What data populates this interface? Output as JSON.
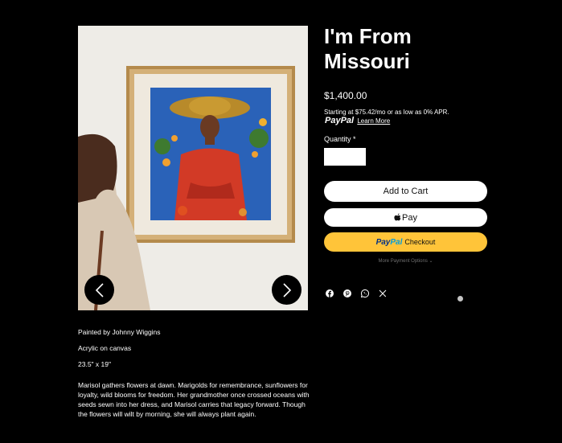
{
  "product": {
    "title_line1": "I'm From",
    "title_line2": "Missouri",
    "price": "$1,400.00",
    "financing_text": "Starting at $75.42/mo or as low as 0% APR.",
    "financing_brand": "PayPal",
    "financing_link": "Learn More",
    "quantity_label": "Quantity *",
    "quantity_value": ""
  },
  "buttons": {
    "add_to_cart": "Add to Cart",
    "apple_pay": "Pay",
    "paypal_brand_1": "Pay",
    "paypal_brand_2": "Pal",
    "paypal_checkout": "Checkout",
    "more_payment": "More Payment Options"
  },
  "gallery": {
    "prev_icon": "chevron-left-icon",
    "next_icon": "chevron-right-icon"
  },
  "share_icons": [
    "facebook-icon",
    "pinterest-icon",
    "whatsapp-icon",
    "x-icon"
  ],
  "details": {
    "artist": "Painted by Johnny Wiggins",
    "medium": "Acrylic on canvas",
    "size": "23.5\" x 19\"",
    "description": "Marisol gathers flowers at dawn. Marigolds for remembrance, sunflowers for loyalty, wild blooms for freedom. Her grandmother once crossed oceans with seeds sewn into her dress, and Marisol carries that legacy forward. Though the flowers will wilt by morning, she will always plant again."
  },
  "colors": {
    "background": "#000000",
    "text": "#ffffff",
    "paypal_yellow": "#ffc439",
    "paypal_dark_blue": "#003087",
    "paypal_light_blue": "#009cde"
  }
}
